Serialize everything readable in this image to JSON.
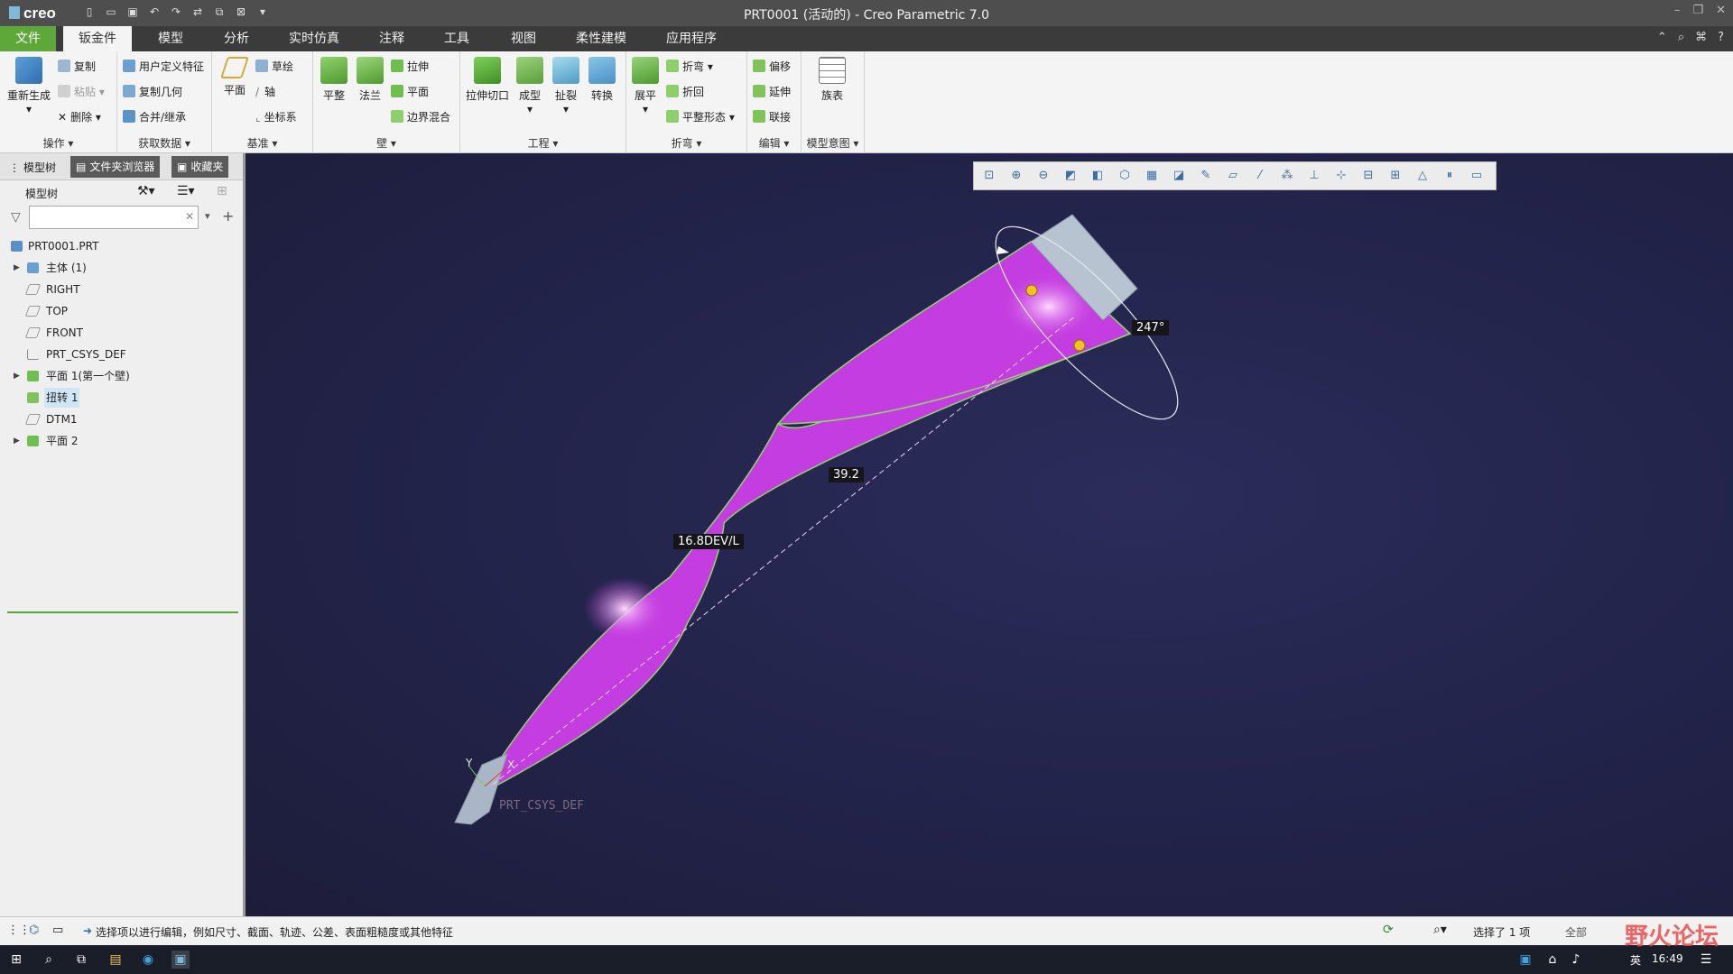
{
  "titlebar": {
    "logo": "creo",
    "title": "PRT0001 (活动的) - Creo Parametric 7.0"
  },
  "menu": {
    "tabs": [
      "文件",
      "钣金件",
      "模型",
      "分析",
      "实时仿真",
      "注释",
      "工具",
      "视图",
      "柔性建模",
      "应用程序"
    ]
  },
  "ribbon": {
    "groups": {
      "caozuo": "操作 ▾",
      "huoqu": "获取数据 ▾",
      "jizhun": "基准 ▾",
      "bi": "壁 ▾",
      "gongcheng": "工程 ▾",
      "zhewan": "折弯 ▾",
      "bianji": "编辑 ▾",
      "moxing": "模型意图 ▾"
    },
    "buttons": {
      "regen": "重新生成",
      "copy": "复制",
      "paste": "粘贴",
      "delete": "删除",
      "udf": "用户定义特征",
      "copygeom": "复制几何",
      "merge": "合并/继承",
      "plane": "平面",
      "sketch": "草绘",
      "axis": "轴",
      "csys": "坐标系",
      "pingzheng": "平整",
      "falan": "法兰",
      "lashen": "拉伸",
      "pingmian": "平面",
      "bianjie": "边界混合",
      "cutext": "拉伸切口",
      "chengxing": "成型",
      "pilie": "扯裂",
      "zhuanhuan": "转换",
      "zhanping": "展平",
      "zhewan": "折弯",
      "zhehui": "折回",
      "pingzhengxingtai": "平整形态",
      "pianyi": "偏移",
      "yanshen": "延伸",
      "lianjie": "联接",
      "zubiao": "族表"
    }
  },
  "sidebar": {
    "tabs": [
      "模型树",
      "文件夹浏览器",
      "收藏夹"
    ],
    "tree_title": "模型树",
    "search_placeholder": "",
    "tree": [
      {
        "label": "PRT0001.PRT",
        "icon": "part-icon",
        "expand": ""
      },
      {
        "label": "主体 (1)",
        "icon": "body-icon",
        "expand": "▶"
      },
      {
        "label": "RIGHT",
        "icon": "datum-plane-icon",
        "expand": ""
      },
      {
        "label": "TOP",
        "icon": "datum-plane-icon",
        "expand": ""
      },
      {
        "label": "FRONT",
        "icon": "datum-plane-icon",
        "expand": ""
      },
      {
        "label": "PRT_CSYS_DEF",
        "icon": "csys-icon",
        "expand": ""
      },
      {
        "label": "平面 1(第一个壁)",
        "icon": "wall-icon",
        "expand": "▶"
      },
      {
        "label": "扭转 1",
        "icon": "twist-icon",
        "expand": ""
      },
      {
        "label": "DTM1",
        "icon": "datum-plane-icon",
        "expand": ""
      },
      {
        "label": "平面 2",
        "icon": "wall-icon",
        "expand": "▶"
      }
    ]
  },
  "viewport": {
    "dim_twist": "39.2",
    "dim_length": "16.8DEV/L",
    "dim_angle": "247°",
    "csys_label": "PRT_CSYS_DEF",
    "axis_x": "X",
    "axis_y": "Y",
    "shape_color": "#c43de0"
  },
  "statusbar": {
    "message": "选择项以进行编辑，例如尺寸、截面、轨迹、公差、表面粗糙度或其他特征",
    "selection": "选择了 1 项",
    "filter": "全部"
  },
  "taskbar": {
    "lang": "英",
    "time": "16:49"
  },
  "watermark": "野火论坛"
}
